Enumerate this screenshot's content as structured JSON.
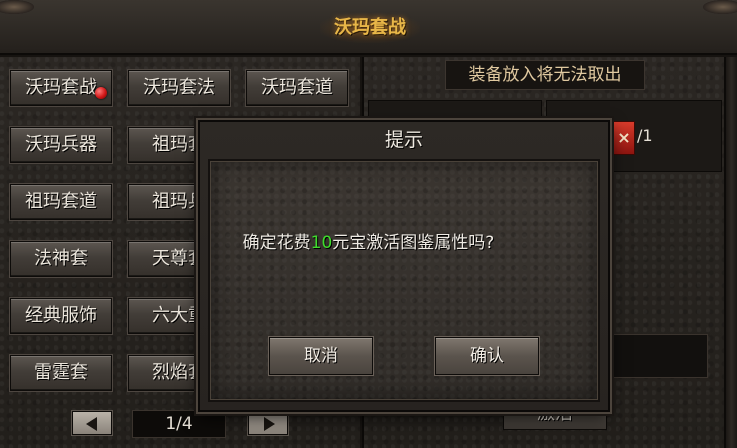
{
  "header": {
    "title": "沃玛套战"
  },
  "set_list": {
    "buttons": [
      {
        "label": "沃玛套战",
        "has_alert": true
      },
      {
        "label": "沃玛套法"
      },
      {
        "label": "沃玛套道"
      },
      {
        "label": "沃玛兵器"
      },
      {
        "label": "祖玛套"
      },
      {
        "label": "祖玛套道"
      },
      {
        "label": "祖玛兵"
      },
      {
        "label": "法神套"
      },
      {
        "label": "天尊套"
      },
      {
        "label": "经典服饰"
      },
      {
        "label": "六大重"
      },
      {
        "label": "雷霆套"
      },
      {
        "label": "烈焰套"
      }
    ]
  },
  "pager": {
    "page": "1/4"
  },
  "equip_panel": {
    "notice": "装备放入将无法取出",
    "close_symbol": "×",
    "slot_count": "/1",
    "activate_label": "激活"
  },
  "dialog": {
    "title": "提示",
    "message_prefix": "确定花费",
    "message_amount": "10",
    "message_suffix": "元宝激活图鉴属性吗?",
    "cancel_label": "取消",
    "confirm_label": "确认"
  },
  "colors": {
    "title_gold": "#e8b648",
    "highlight_green": "#3fdc2c",
    "close_red": "#d83b2b"
  }
}
